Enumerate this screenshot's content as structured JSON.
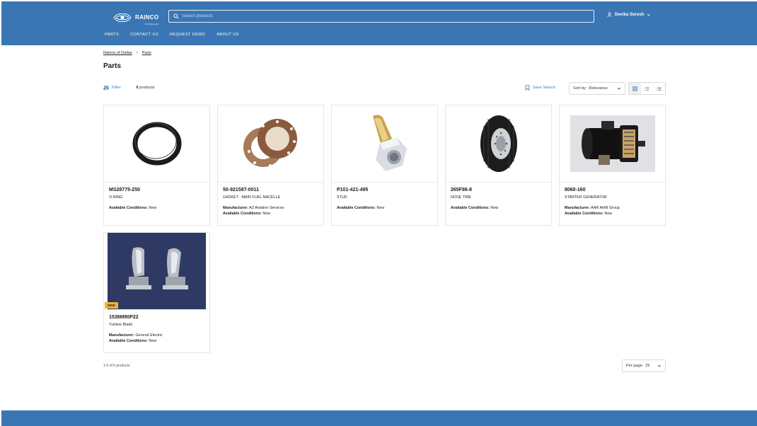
{
  "header": {
    "brand": "RAINCO",
    "brand_sub": "OF DALLAS",
    "search_placeholder": "Search products",
    "user_name": "Devika Suresh",
    "nav": [
      "PARTS",
      "CONTACT US",
      "REQUEST DEMO",
      "ABOUT US"
    ]
  },
  "breadcrumb": {
    "root": "Rainco of Dallas",
    "current": "Parts"
  },
  "page": {
    "title": "Parts"
  },
  "toolbar": {
    "filter_label": "Filter",
    "count_number": "6",
    "count_suffix": "products",
    "save_search_label": "Save Search",
    "sort_label": "Sort by:",
    "sort_value": "Relevance"
  },
  "labels": {
    "manufacturer": "Manufacturer:",
    "conditions": "Available Conditions:"
  },
  "products": [
    {
      "pn": "MS28775-250",
      "desc": "O-RING",
      "manufacturer": "",
      "conditions": "New"
    },
    {
      "pn": "50-921587-0011",
      "desc": "GASKET - MAIN FUEL NACELLE",
      "manufacturer": "AZ Aviation Services",
      "conditions": "New"
    },
    {
      "pn": "P101-421-495",
      "desc": "STUD",
      "manufacturer": "",
      "conditions": "New"
    },
    {
      "pn": "265F86-8",
      "desc": "NOSE TIRE",
      "manufacturer": "",
      "conditions": "New"
    },
    {
      "pn": "8060-160",
      "desc": "STARTER GENERATOR",
      "manufacturer": "AAR Airlift Group",
      "conditions": "New"
    },
    {
      "pn": "1538M90P22",
      "desc": "Turbine Blade",
      "manufacturer": "General Electric",
      "conditions": "New",
      "badge": "NEW"
    }
  ],
  "pagination": {
    "summary": "1-6 of 6 products",
    "per_page_label": "Per page:",
    "per_page_value": "25"
  },
  "colors": {
    "brand_blue": "#3b76b4",
    "badge_yellow": "#f0b43a"
  }
}
